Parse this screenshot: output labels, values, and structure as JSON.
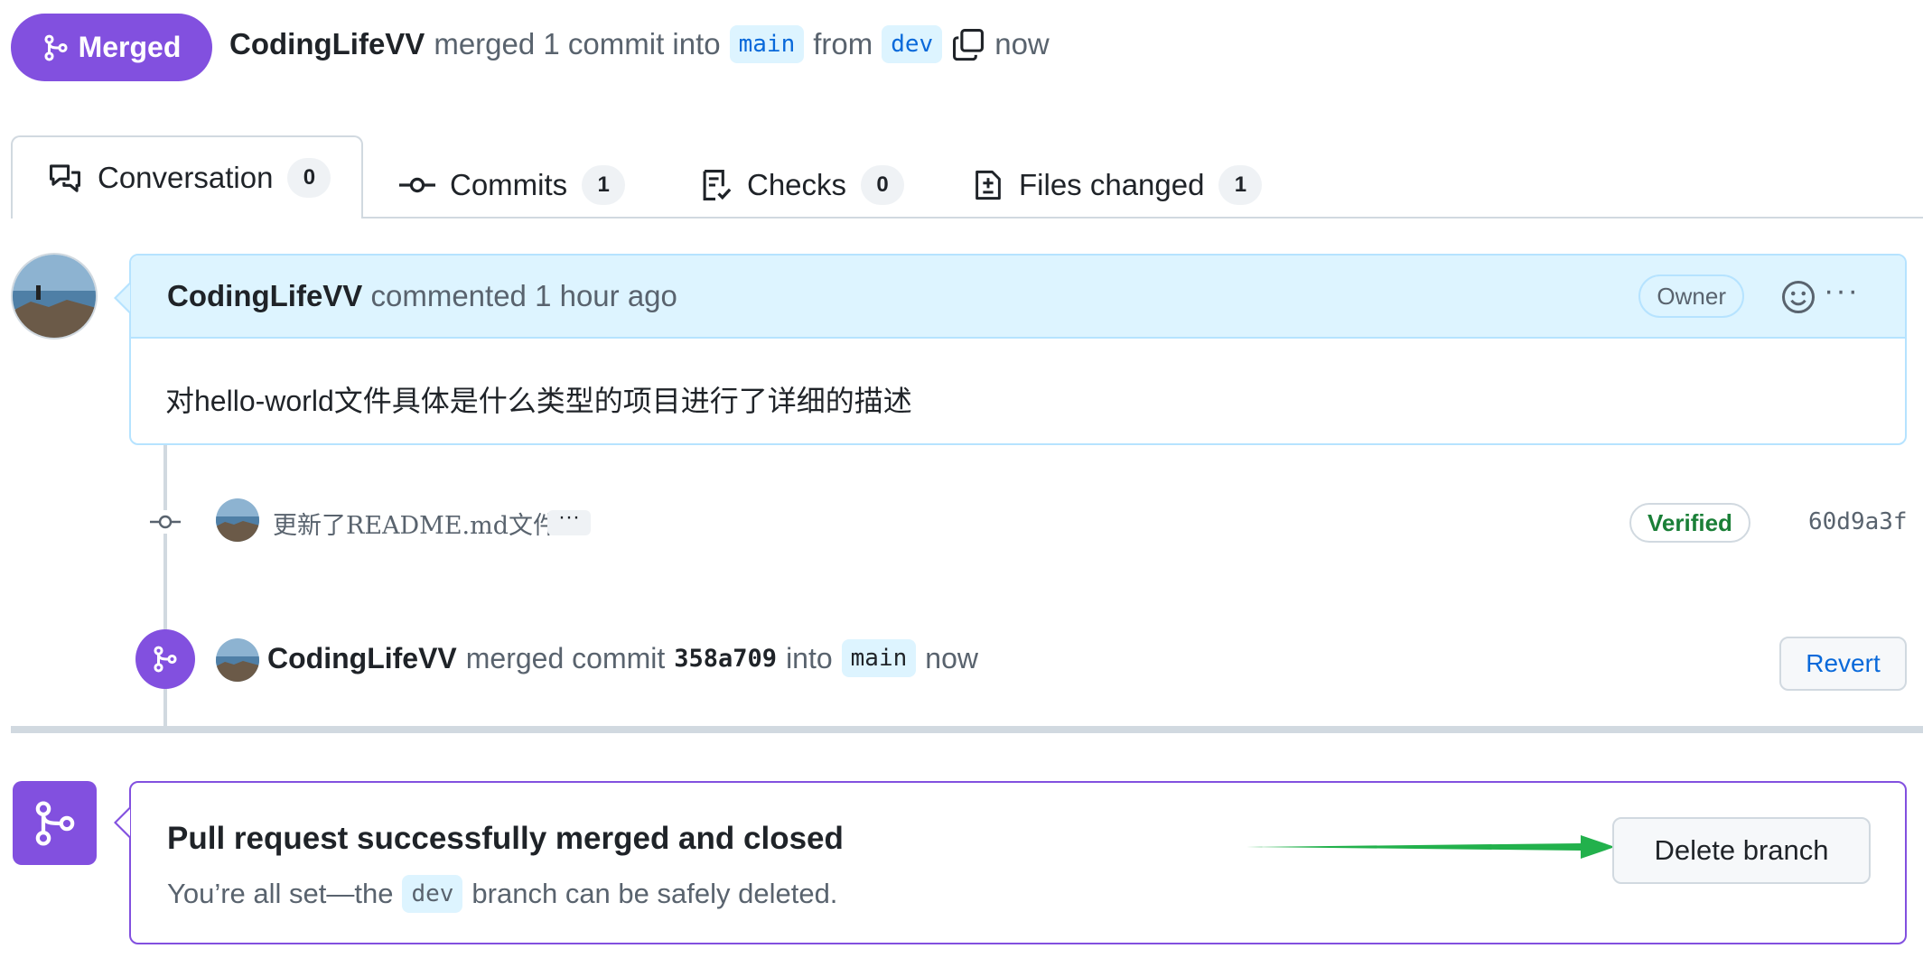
{
  "header": {
    "state_label": "Merged",
    "author": "CodingLifeVV",
    "merged_text": "merged 1 commit into",
    "base_branch": "main",
    "from_text": "from",
    "head_branch": "dev",
    "time": "now"
  },
  "tabs": [
    {
      "label": "Conversation",
      "count": "0",
      "icon": "comment-discussion-icon"
    },
    {
      "label": "Commits",
      "count": "1",
      "icon": "git-commit-icon"
    },
    {
      "label": "Checks",
      "count": "0",
      "icon": "checklist-icon"
    },
    {
      "label": "Files changed",
      "count": "1",
      "icon": "file-diff-icon"
    }
  ],
  "comment": {
    "author": "CodingLifeVV",
    "action": "commented 1 hour ago",
    "role_badge": "Owner",
    "body": "对hello-world文件具体是什么类型的项目进行了详细的描述",
    "more_label": "···"
  },
  "commit": {
    "message": "更新了README.md文件",
    "expand_label": "···",
    "verified_label": "Verified",
    "sha": "60d9a3f"
  },
  "merge_event": {
    "author": "CodingLifeVV",
    "text": "merged commit",
    "sha": "358a709",
    "into_text": "into",
    "branch": "main",
    "time": "now",
    "revert_label": "Revert"
  },
  "merged_box": {
    "title": "Pull request successfully merged and closed",
    "sub_prefix": "You’re all set—the",
    "branch": "dev",
    "sub_suffix": "branch can be safely deleted.",
    "delete_label": "Delete branch"
  },
  "colors": {
    "merged_purple": "#8250df",
    "link_blue": "#0969da",
    "verified_green": "#1a7f37",
    "annotation_arrow": "#22b14c"
  }
}
